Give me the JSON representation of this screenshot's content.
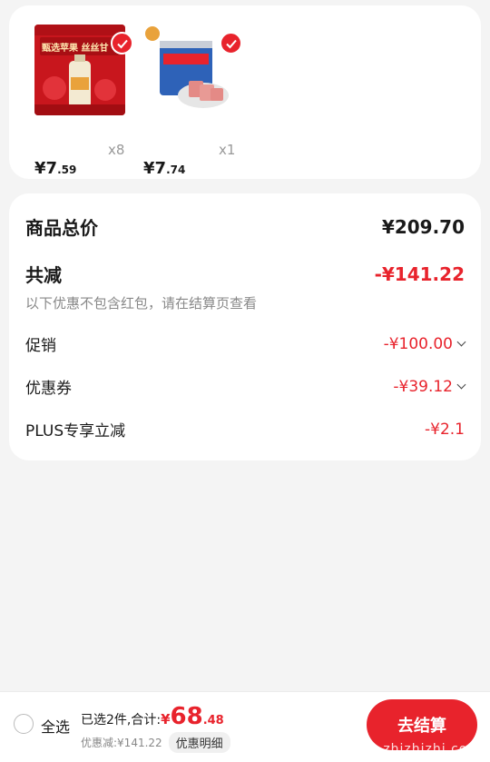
{
  "colors": {
    "accent": "#e8232c",
    "muted": "#888888",
    "background": "#f4f4f4"
  },
  "products": [
    {
      "image": "apple-juice-product-image",
      "image_caption": "甄选苹果 丝丝甘",
      "price_symbol": "¥",
      "price_int": "7",
      "price_dec": ".59",
      "quantity": "x8",
      "selected": true
    },
    {
      "image": "luncheon-meat-can-image",
      "price_symbol": "¥",
      "price_int": "7",
      "price_dec": ".74",
      "quantity": "x1",
      "selected": true
    }
  ],
  "summary": {
    "total_label": "商品总价",
    "total_value": "¥209.70",
    "reduce_label": "共减",
    "reduce_value": "-¥141.22",
    "note": "以下优惠不包含红包，请在结算页查看",
    "promo_label": "促销",
    "promo_value": "-¥100.00",
    "coupon_label": "优惠券",
    "coupon_value": "-¥39.12",
    "plus_label": "PLUS专享立减",
    "plus_value": "-¥2.1"
  },
  "bottom_bar": {
    "select_all": "全选",
    "selected_text": "已选2件,合计:",
    "total_symbol": "¥",
    "total_int": "68",
    "total_dec": ".48",
    "saved_text": "优惠减:¥141.22",
    "detail_button": "优惠明细",
    "checkout_button": "去结算",
    "watermark": "zhizhizhi.com"
  }
}
